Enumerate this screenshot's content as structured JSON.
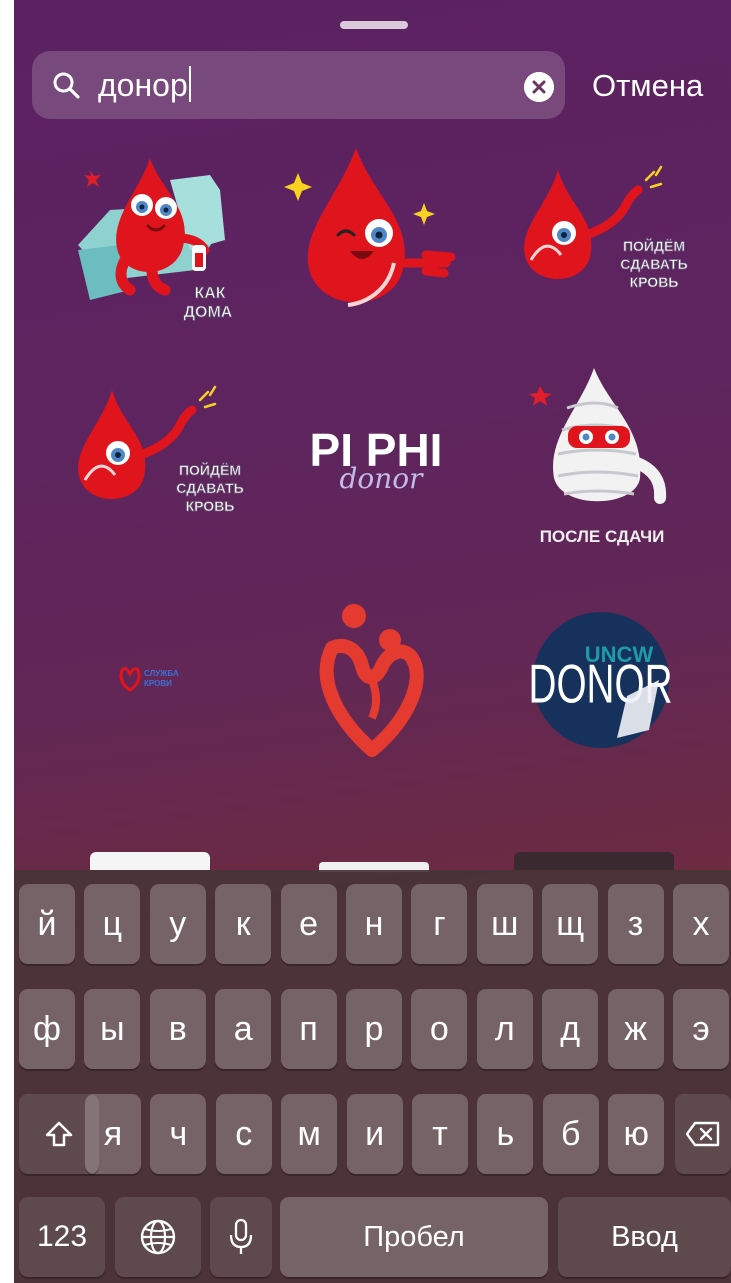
{
  "search": {
    "query": "донор",
    "cancel_label": "Отмена"
  },
  "stickers": [
    {
      "name": "blood-drop-kak-doma",
      "caption": "КАК ДОМА"
    },
    {
      "name": "blood-drop-wink"
    },
    {
      "name": "blood-drop-poydem-1",
      "caption": "ПОЙДЁМ СДАВАТЬ КРОВЬ"
    },
    {
      "name": "blood-drop-poydem-2",
      "caption": "ПОЙДЁМ СДАВАТЬ КРОВЬ"
    },
    {
      "name": "pi-phi-donor",
      "line1": "PI PHI",
      "line2": "donor"
    },
    {
      "name": "bandaged-drop",
      "caption": "ПОСЛЕ СДАЧИ"
    },
    {
      "name": "sluzhba-krovi-logo",
      "line1": "СЛУЖБА",
      "line2": "КРОВИ"
    },
    {
      "name": "heart-figures-logo"
    },
    {
      "name": "uncw-donor-badge",
      "line1": "UNCW",
      "line2": "DONOR"
    }
  ],
  "keyboard": {
    "row1": [
      "й",
      "ц",
      "у",
      "к",
      "е",
      "н",
      "г",
      "ш",
      "щ",
      "з",
      "х"
    ],
    "row2": [
      "ф",
      "ы",
      "в",
      "а",
      "п",
      "р",
      "о",
      "л",
      "д",
      "ж",
      "э"
    ],
    "row3": [
      "я",
      "ч",
      "с",
      "м",
      "и",
      "т",
      "ь",
      "б",
      "ю"
    ],
    "numbers_label": "123",
    "space_label": "Пробел",
    "return_label": "Ввод",
    "icons": {
      "shift": "shift-icon",
      "delete": "delete-icon",
      "globe": "globe-icon",
      "mic": "microphone-icon"
    }
  }
}
